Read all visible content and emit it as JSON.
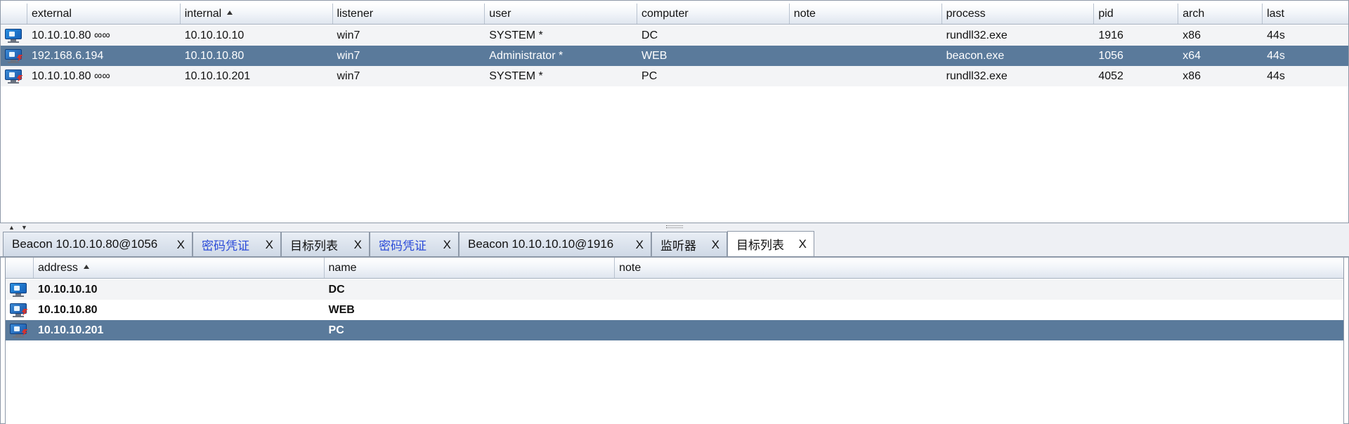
{
  "sessions": {
    "columns": [
      "",
      "external",
      "internal",
      "listener",
      "user",
      "computer",
      "note",
      "process",
      "pid",
      "arch",
      "last"
    ],
    "sorted_column": "internal",
    "sort_direction": "ascending",
    "rows": [
      {
        "icon": "windows-monitor-icon",
        "external": "10.10.10.80 ∞∞",
        "internal": "10.10.10.10",
        "listener": "win7",
        "user": "SYSTEM *",
        "computer": "DC",
        "note": "",
        "process": "rundll32.exe",
        "pid": "1916",
        "arch": "x86",
        "last": "44s",
        "selected": false
      },
      {
        "icon": "compromised-monitor-icon",
        "external": "192.168.6.194",
        "internal": "10.10.10.80",
        "listener": "win7",
        "user": "Administrator *",
        "computer": "WEB",
        "note": "",
        "process": "beacon.exe",
        "pid": "1056",
        "arch": "x64",
        "last": "44s",
        "selected": true
      },
      {
        "icon": "compromised-monitor-icon",
        "external": "10.10.10.80 ∞∞",
        "internal": "10.10.10.201",
        "listener": "win7",
        "user": "SYSTEM *",
        "computer": "PC",
        "note": "",
        "process": "rundll32.exe",
        "pid": "4052",
        "arch": "x86",
        "last": "44s",
        "selected": false
      }
    ]
  },
  "tabs": [
    {
      "label": "Beacon 10.10.10.80@1056",
      "close": "X",
      "blue": false,
      "active": false
    },
    {
      "label": "密码凭证",
      "close": "X",
      "blue": true,
      "active": false
    },
    {
      "label": "目标列表",
      "close": "X",
      "blue": false,
      "active": false
    },
    {
      "label": "密码凭证",
      "close": "X",
      "blue": true,
      "active": false
    },
    {
      "label": "Beacon 10.10.10.10@1916",
      "close": "X",
      "blue": false,
      "active": false
    },
    {
      "label": "监听器",
      "close": "X",
      "blue": false,
      "active": false
    },
    {
      "label": "目标列表",
      "close": "X",
      "blue": false,
      "active": true
    }
  ],
  "targets": {
    "columns": [
      "",
      "address",
      "name",
      "note"
    ],
    "sorted_column": "address",
    "rows": [
      {
        "icon": "windows-monitor-icon",
        "address": "10.10.10.10",
        "name": "DC",
        "note": "",
        "selected": false
      },
      {
        "icon": "compromised-monitor-icon",
        "address": "10.10.10.80",
        "name": "WEB",
        "note": "",
        "selected": false
      },
      {
        "icon": "compromised-monitor-icon",
        "address": "10.10.10.201",
        "name": "PC",
        "note": "",
        "selected": true
      }
    ]
  },
  "colors": {
    "selection": "#5a7a9b",
    "tab_blue_text": "#2b4bd8"
  }
}
